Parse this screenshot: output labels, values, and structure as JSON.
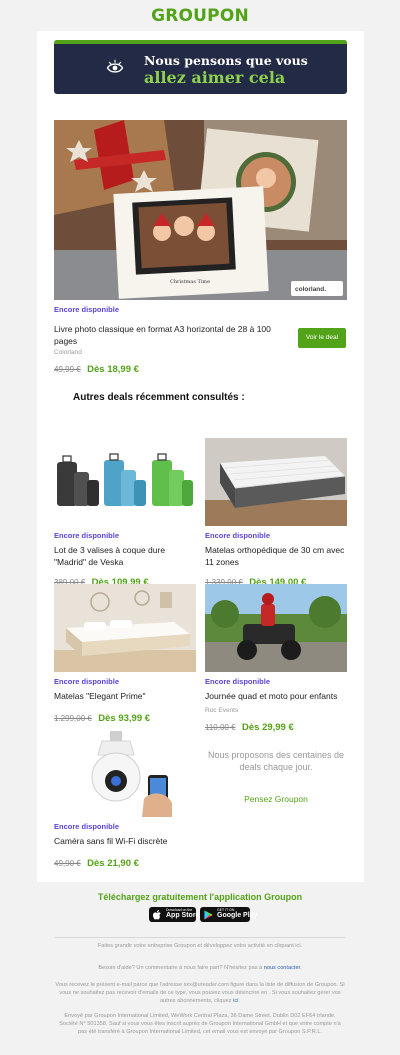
{
  "brand": {
    "logo": "GROUPON"
  },
  "banner": {
    "line1": "Nous pensons que vous",
    "line2": "allez aimer cela",
    "icon": "eye-icon"
  },
  "hero": {
    "availability": "Encore disponible",
    "title": "Livre photo classique en format A3 horizontal de 28 à 100 pages",
    "merchant": "Colorland",
    "old_price": "49,99 €",
    "new_price": "Dès 18,99 €",
    "button_label": "Voir le deal",
    "image_caption": "Christmas Time",
    "image_logo": "colorland."
  },
  "section_title": "Autres deals récemment consultés :",
  "deals": [
    {
      "availability": "Encore disponible",
      "title": "Lot de 3 valises à coque dure \"Madrid\" de Veska",
      "merchant": "",
      "old_price": "389,00 €",
      "new_price": "Dès 109,99 €"
    },
    {
      "availability": "Encore disponible",
      "title": "Matelas orthopédique de 30 cm avec 11 zones",
      "merchant": "",
      "old_price": "1.339,00 €",
      "new_price": "Dès 149,00 €"
    },
    {
      "availability": "Encore disponible",
      "title": "Matelas \"Elegant Prime\"",
      "merchant": "",
      "old_price": "1.299,00 €",
      "new_price": "Dès 93,99 €"
    },
    {
      "availability": "Encore disponible",
      "title": "Journée quad et moto pour enfants",
      "merchant": "Roc Events",
      "old_price": "110,00 €",
      "new_price": "Dès 29,99 €"
    },
    {
      "availability": "Encore disponible",
      "title": "Caméra sans fil Wi-Fi discrète",
      "merchant": "",
      "old_price": "49,90 €",
      "new_price": "Dès 21,90 €"
    }
  ],
  "promo": {
    "text": "Nous proposons des centaines de deals chaque jour.",
    "link": "Pensez Groupon"
  },
  "app": {
    "title": "Téléchargez gratuitement l'application Groupon",
    "appstore_small": "Download on the",
    "appstore_big": "App Store",
    "googleplay_small": "GET IT ON",
    "googleplay_big": "Google Play"
  },
  "footer": {
    "grow": "Faites grandir votre entreprise Groupon et développez votre activité en cliquant ici.",
    "help_text": "Besoin d'aide? Un commentaire à nous faire part? N'hésitez pas à",
    "help_link": "nous contacter",
    "help_end": ".",
    "unsub_text": "Vous recevez le présent e-mail parce que l'adresse sxx@ureader.com figure dans la liste de diffusion de Groupon. Si vous ne souhaitez pas recevoir d'emails de ce type, vous pouvez vous désincrire en . Si vous souhaitez gérer vos autres abonnements, cliquez",
    "unsub_link": "ici",
    "unsub_end": ".",
    "legal": "Envoyé par Groupon International Limited, WeWork Central Plaza, 36 Dame Street, Dublin D02 EF64 Irlande. Société N° 501358. Sauf si vous vous êtes inscrit auprès de Groupon International GmbH et que votre compte n'a pas été transféré à Groupon International Limited, cet email vous est envoyé par Groupon S.P.R.L."
  },
  "colors": {
    "brand_green": "#53a318",
    "availability_purple": "#5b45d6",
    "banner_navy": "#222a45",
    "link_blue": "#2a5db0"
  }
}
